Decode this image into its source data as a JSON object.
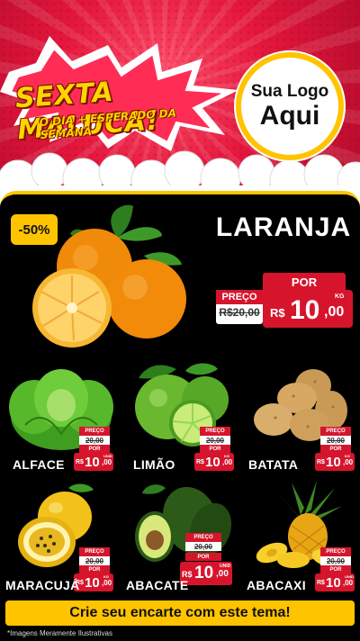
{
  "header": {
    "title": "SEXTA MALUCA!",
    "subtitle": "O DIA + ESPERADO DA SEMANA",
    "logo_line1": "Sua Logo",
    "logo_line2": "Aqui"
  },
  "colors": {
    "header_red": "#e5173d",
    "price_red": "#d6152c",
    "accent_yellow": "#ffc400",
    "panel_black": "#000000"
  },
  "feature": {
    "discount": "-50%",
    "name": "LARANJA",
    "preco_label": "PREÇO",
    "old_price": "R$20,00",
    "por_label": "POR",
    "currency": "R$",
    "price_int": "10",
    "price_cents": ",00",
    "unit": "KG",
    "image_icon": "orange-icon"
  },
  "products": [
    {
      "name": "ALFACE",
      "preco_label": "PREÇO",
      "old_price": "20,00",
      "por_label": "POR",
      "currency": "R$",
      "price_int": "10",
      "price_cents": ",00",
      "unit": "UNID",
      "icon": "lettuce-icon"
    },
    {
      "name": "LIMÃO",
      "preco_label": "PREÇO",
      "old_price": "20,00",
      "por_label": "POR",
      "currency": "R$",
      "price_int": "10",
      "price_cents": ",00",
      "unit": "KG",
      "icon": "lime-icon"
    },
    {
      "name": "BATATA",
      "preco_label": "PREÇO",
      "old_price": "20,00",
      "por_label": "POR",
      "currency": "R$",
      "price_int": "10",
      "price_cents": ",00",
      "unit": "KG",
      "icon": "potato-icon"
    },
    {
      "name": "MARACUJÁ",
      "preco_label": "PREÇO",
      "old_price": "20,00",
      "por_label": "POR",
      "currency": "R$",
      "price_int": "10",
      "price_cents": ",00",
      "unit": "KG",
      "icon": "passion-fruit-icon"
    },
    {
      "name": "ABACATE",
      "preco_label": "PREÇO",
      "old_price": "20,00",
      "por_label": "POR",
      "currency": "R$",
      "price_int": "10",
      "price_cents": ",00",
      "unit": "UNID",
      "icon": "avocado-icon"
    },
    {
      "name": "ABACAXI",
      "preco_label": "PREÇO",
      "old_price": "20,00",
      "por_label": "POR",
      "currency": "R$",
      "price_int": "10",
      "price_cents": ",00",
      "unit": "UNID",
      "icon": "pineapple-icon"
    }
  ],
  "cta": "Crie seu encarte com este tema!",
  "disclaimer": "*Imagens Meramente Ilustrativas"
}
